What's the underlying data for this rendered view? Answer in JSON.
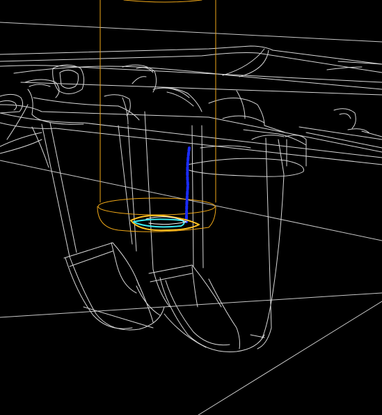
{
  "viewport": {
    "background_color": "#000000",
    "background_label": "",
    "wireframe_color": "#d8d8d8",
    "tool_cylinder_color": "#f0a818",
    "tool_path_color": "#1a2cff",
    "toolpath_highlight_color": "#38e8f0",
    "contact_ring_color": "#ffc020"
  }
}
